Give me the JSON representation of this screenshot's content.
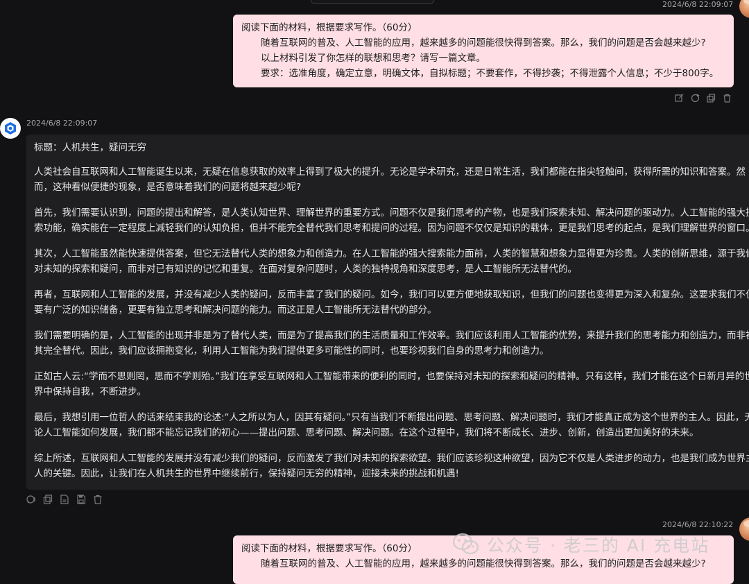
{
  "conversation": {
    "messages": [
      {
        "role": "user",
        "timestamp": "2024/6/8 22:09:07",
        "lines": [
          "阅读下面的材料，根据要求写作。（60分）",
          "随着互联网的普及、人工智能的应用，越来越多的问题能很快得到答案。那么，我们的问题是否会越来越少?",
          "以上材料引发了你怎样的联想和思考？请写一篇文章。",
          "要求：选准角度，确定立意，明确文体，自拟标题；不要套作，不得抄袭；不得泄露个人信息；不少于800字。"
        ]
      },
      {
        "role": "assistant",
        "timestamp": "2024/6/8 22:09:07",
        "paragraphs": [
          "标题：人机共生，疑问无穷",
          "人类社会自互联网和人工智能诞生以来，无疑在信息获取的效率上得到了极大的提升。无论是学术研究，还是日常生活，我们都能在指尖轻触间，获得所需的知识和答案。然而，这种看似便捷的现象，是否意味着我们的问题将越来越少呢?",
          "首先，我们需要认识到，问题的提出和解答，是人类认知世界、理解世界的重要方式。问题不仅是我们思考的产物，也是我们探索未知、解决问题的驱动力。人工智能的强大搜索功能，确实能在一定程度上减轻我们的认知负担，但并不能完全替代我们思考和提问的过程。因为问题不仅仅是知识的载体，更是我们思考的起点，是我们理解世界的窗口。",
          "其次，人工智能虽然能快速提供答案，但它无法替代人类的想象力和创造力。在人工智能的强大搜索能力面前，人类的智慧和想象力显得更为珍贵。人类的创新思维，源于我们对未知的探索和疑问，而非对已有知识的记忆和重复。在面对复杂问题时，人类的独特视角和深度思考，是人工智能所无法替代的。",
          "再者，互联网和人工智能的发展，并没有减少人类的疑问，反而丰富了我们的疑问。如今，我们可以更方便地获取知识，但我们的问题也变得更为深入和复杂。这要求我们不仅要有广泛的知识储备，更要有独立思考和解决问题的能力。而这正是人工智能所无法替代的部分。",
          "我们需要明确的是，人工智能的出现并非是为了替代人类，而是为了提高我们的生活质量和工作效率。我们应该利用人工智能的优势，来提升我们的思考能力和创造力，而非被其完全替代。因此，我们应该拥抱变化，利用人工智能为我们提供更多可能性的同时，也要珍视我们自身的思考力和创造力。",
          "正如古人云:“学而不思则罔，思而不学则殆。”我们在享受互联网和人工智能带来的便利的同时，也要保持对未知的探索和疑问的精神。只有这样，我们才能在这个日新月异的世界中保持自我，不断进步。",
          "最后，我想引用一位哲人的话来结束我的论述:“人之所以为人，因其有疑问。”只有当我们不断提出问题、思考问题、解决问题时，我们才能真正成为这个世界的主人。因此，无论人工智能如何发展，我们都不能忘记我们的初心——提出问题、思考问题、解决问题。在这个过程中，我们将不断成长、进步、创新，创造出更加美好的未来。",
          "综上所述，互联网和人工智能的发展并没有减少我们的疑问，反而激发了我们对未知的探索欲望。我们应该珍视这种欲望，因为它不仅是人类进步的动力，也是我们成为世界主人的关键。因此，让我们在人机共生的世界中继续前行，保持疑问无穷的精神，迎接未来的挑战和机遇!"
        ]
      },
      {
        "role": "user",
        "timestamp": "2024/6/8 22:10:22",
        "lines": [
          "阅读下面的材料，根据要求写作。（60分）",
          "随着互联网的普及、人工智能的应用，越来越多的问题能很快得到答案。那么，我们的问题是否会越来越少?"
        ]
      }
    ]
  },
  "icons": {
    "user_tools": [
      "edit-icon",
      "refresh-icon",
      "copy-icon",
      "delete-icon"
    ],
    "bot_tools": [
      "speak-icon",
      "copy-icon",
      "export-icon",
      "save-icon",
      "delete-icon"
    ]
  },
  "watermark": {
    "text": "公众号 · 老三的 AI 充电站"
  },
  "colors": {
    "background": "#121214",
    "user_bubble": "#ffdfe5",
    "bot_bubble": "#1f1f22",
    "bot_logo": "#1f6fe0"
  }
}
